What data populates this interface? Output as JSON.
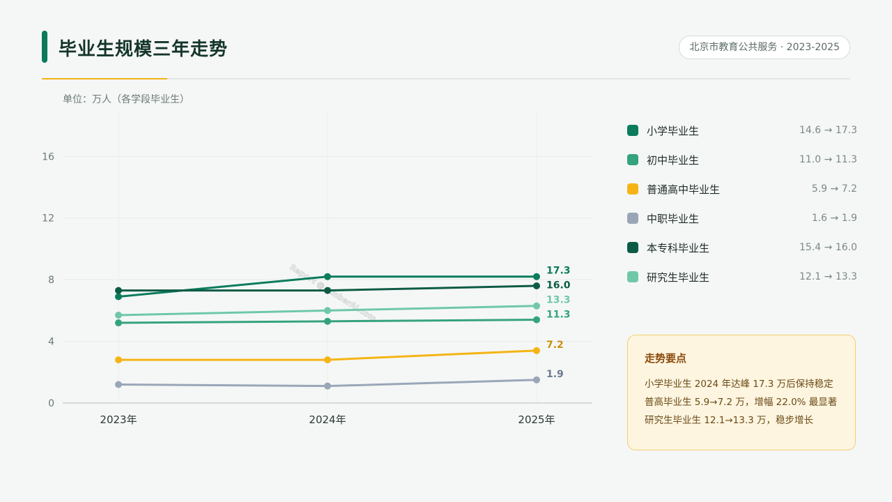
{
  "header": {
    "title": "毕业生规模三年走势",
    "source": "北京市教育公共服务 · 2023-2025",
    "unit": "单位：万人（各学段毕业生）"
  },
  "chart_data": {
    "type": "line",
    "x": [
      "2023年",
      "2024年",
      "2025年"
    ],
    "yticks": [
      0,
      4,
      8,
      12,
      16
    ],
    "ylim": [
      0,
      19
    ],
    "grid": true,
    "series": [
      {
        "name": "小学毕业生",
        "color": "#0c7c5c",
        "values": [
          6.9,
          8.2,
          8.2
        ],
        "end_label": "17.3",
        "range": "14.6 → 17.3"
      },
      {
        "name": "初中毕业生",
        "color": "#35a37c",
        "values": [
          5.2,
          5.3,
          5.4
        ],
        "end_label": "11.3",
        "range": "11.0 → 11.3"
      },
      {
        "name": "普通高中毕业生",
        "color": "#f5b416",
        "values": [
          2.8,
          2.8,
          3.4
        ],
        "end_label": "7.2",
        "range": "5.9 → 7.2"
      },
      {
        "name": "中职毕业生",
        "color": "#9aa6b8",
        "values": [
          1.2,
          1.1,
          1.5
        ],
        "end_label": "1.9",
        "range": "1.6 → 1.9"
      },
      {
        "name": "本专科毕业生",
        "color": "#0e5b45",
        "values": [
          7.3,
          7.3,
          7.6
        ],
        "end_label": "16.0",
        "range": "15.4 → 16.0"
      },
      {
        "name": "研究生毕业生",
        "color": "#6fc8a8",
        "values": [
          5.7,
          6.0,
          6.3
        ],
        "end_label": "13.3",
        "range": "12.1 → 13.3"
      }
    ],
    "label_colors": {
      "16.0": "#0e5b45",
      "17.3": "#0c7c5c",
      "13.3": "#6fc8a8",
      "11.3": "#35a37c",
      "7.2": "#c79208",
      "1.9": "#6b7a90"
    },
    "watermark": "Report @ AmberAI.com"
  },
  "note": {
    "title": "走势要点",
    "lines": [
      "小学毕业生 2024 年达峰 17.3 万后保持稳定",
      "普高毕业生 5.9→7.2 万，增幅 22.0% 最显著",
      "研究生毕业生 12.1→13.3 万，稳步增长"
    ]
  },
  "colors": {
    "accent": "#0a7a5a",
    "highlight": "#f5b416",
    "background": "#f5f7f6"
  }
}
